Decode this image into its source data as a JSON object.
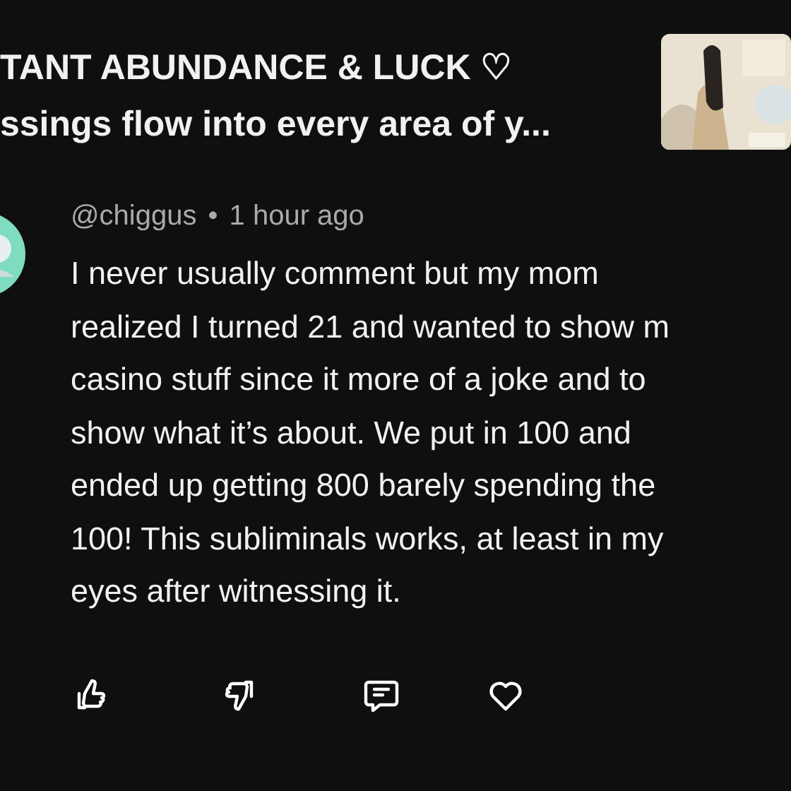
{
  "video": {
    "title_lines": [
      "TANT ABUNDANCE & LUCK ♡",
      "ssings flow into every area of y..."
    ]
  },
  "comment": {
    "author": "@chiggus",
    "separator": "•",
    "time": "1 hour ago",
    "body_lines": [
      "I never usually comment but my mom",
      "realized I turned 21 and wanted to show m",
      "casino stuff since it more of a joke and to",
      "show what it’s about. We put in 100 and",
      "ended up getting 800 barely spending the",
      "100! This subliminals works, at least in my",
      "eyes after witnessing it."
    ],
    "liked": false,
    "disliked": false,
    "hearted": false
  }
}
